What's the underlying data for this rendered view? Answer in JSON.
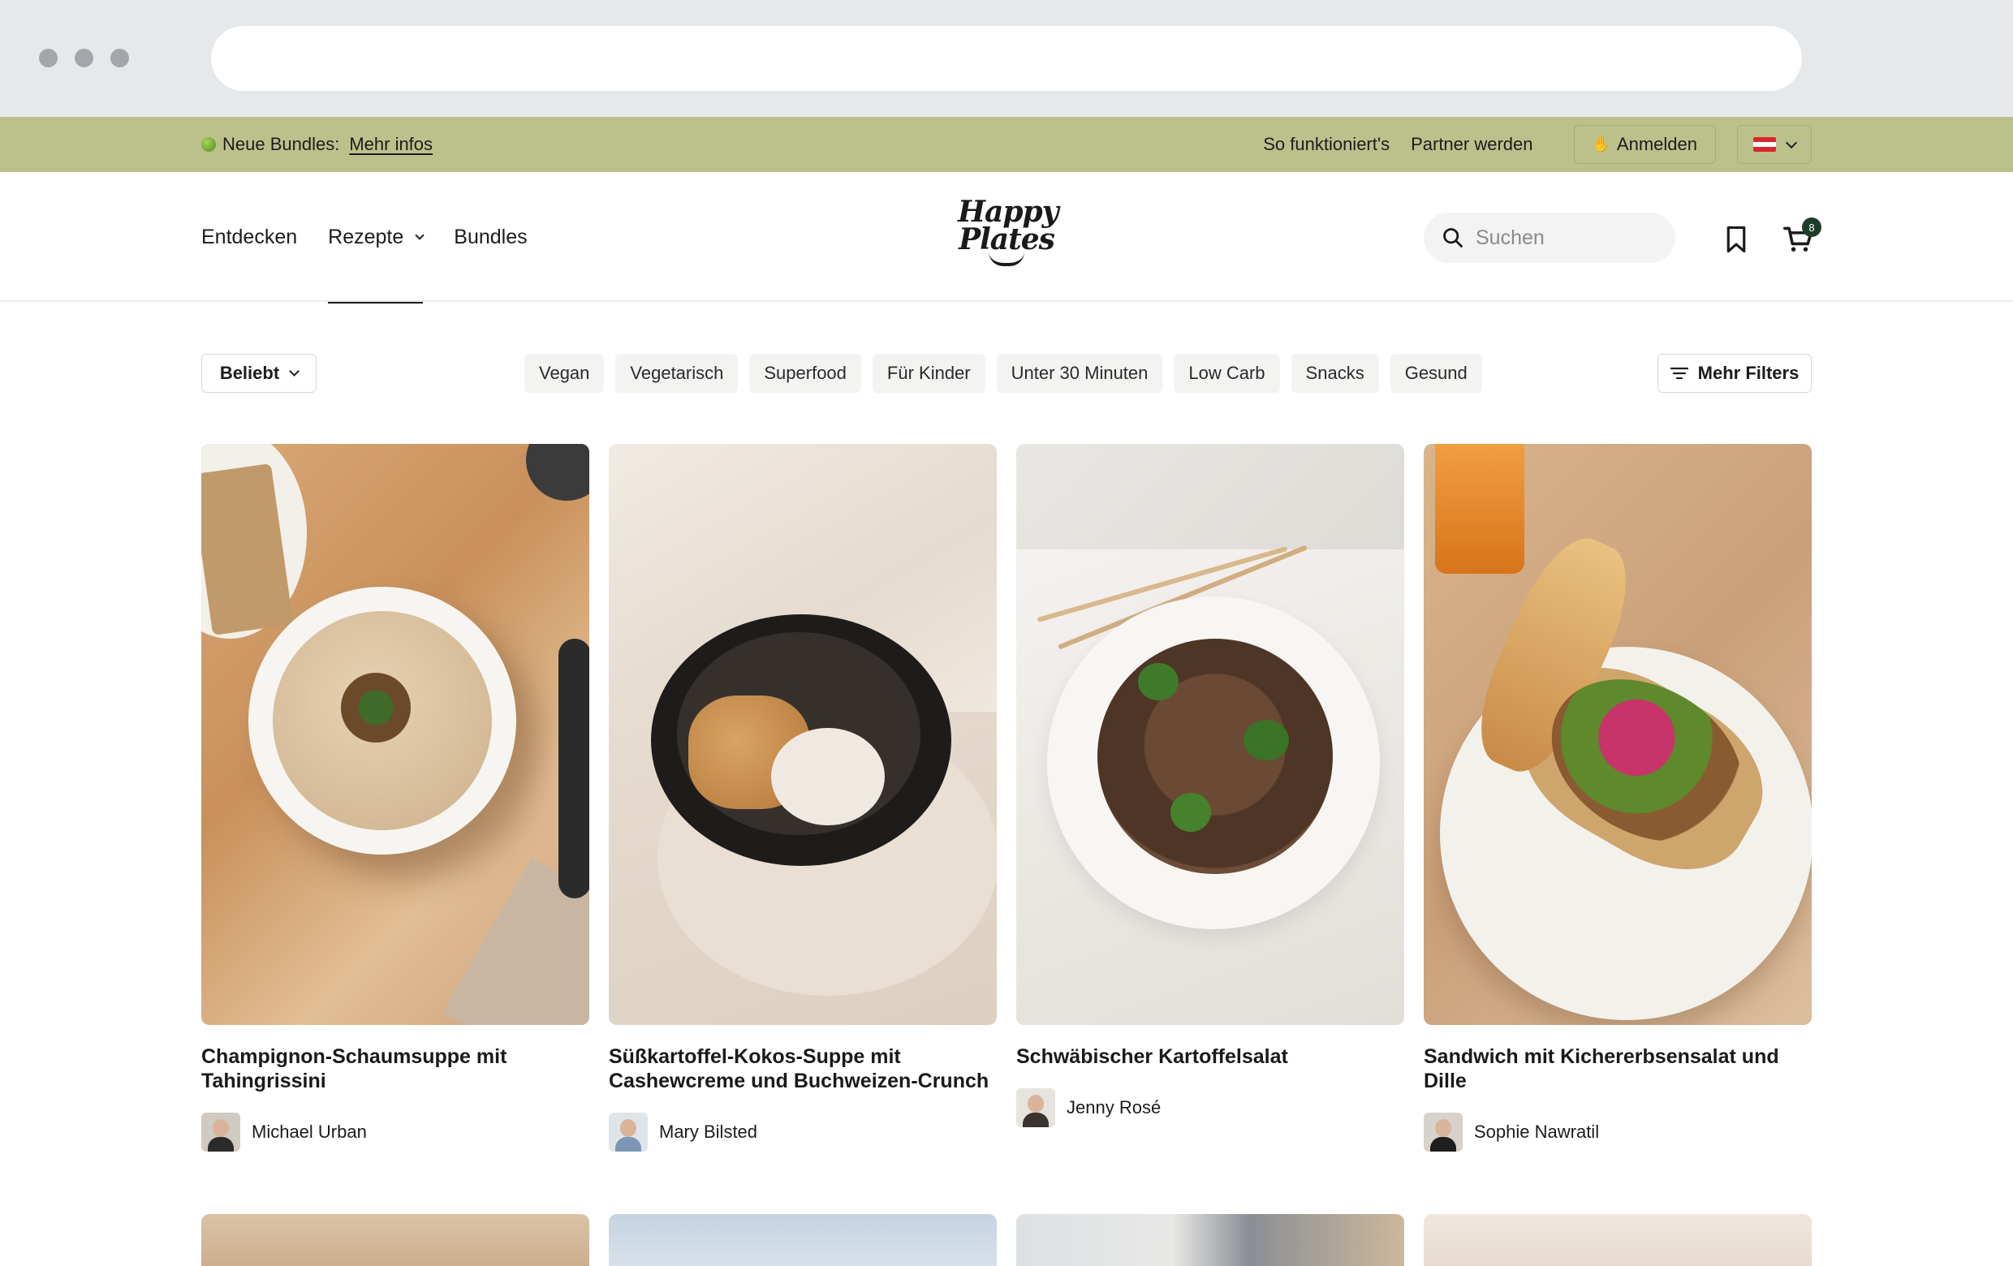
{
  "announcement": {
    "icon": "apple-icon",
    "text": "Neue Bundles:",
    "link": "Mehr infos",
    "how_it_works": "So funktioniert's",
    "partner": "Partner werden",
    "login": "Anmelden",
    "language_flag": "austria-flag-icon"
  },
  "header": {
    "nav": [
      {
        "label": "Entdecken"
      },
      {
        "label": "Rezepte",
        "active": true,
        "has_dropdown": true
      },
      {
        "label": "Bundles"
      }
    ],
    "logo": {
      "line1": "Happy",
      "line2": "Plates"
    },
    "search_placeholder": "Suchen",
    "cart_count": "8"
  },
  "filters": {
    "sort": "Beliebt",
    "chips": [
      "Vegan",
      "Vegetarisch",
      "Superfood",
      "Für Kinder",
      "Unter 30 Minuten",
      "Low Carb",
      "Snacks",
      "Gesund"
    ],
    "more": "Mehr Filters"
  },
  "recipes": [
    {
      "title": "Champignon-Schaumsuppe mit Tahingrissini",
      "author": "Michael Urban"
    },
    {
      "title": "Süßkartoffel-Kokos-Suppe mit Cashewcreme und Buchweizen-Crunch",
      "author": "Mary Bilsted"
    },
    {
      "title": "Schwäbischer Kartoffelsalat",
      "author": "Jenny Rosé"
    },
    {
      "title": "Sandwich mit Kichererbsensalat und Dille",
      "author": "Sophie Nawratil"
    }
  ],
  "colors": {
    "announcement_bg": "#bcc18b",
    "chip_bg": "#f3f3f1",
    "badge": "#1f3e2a"
  }
}
